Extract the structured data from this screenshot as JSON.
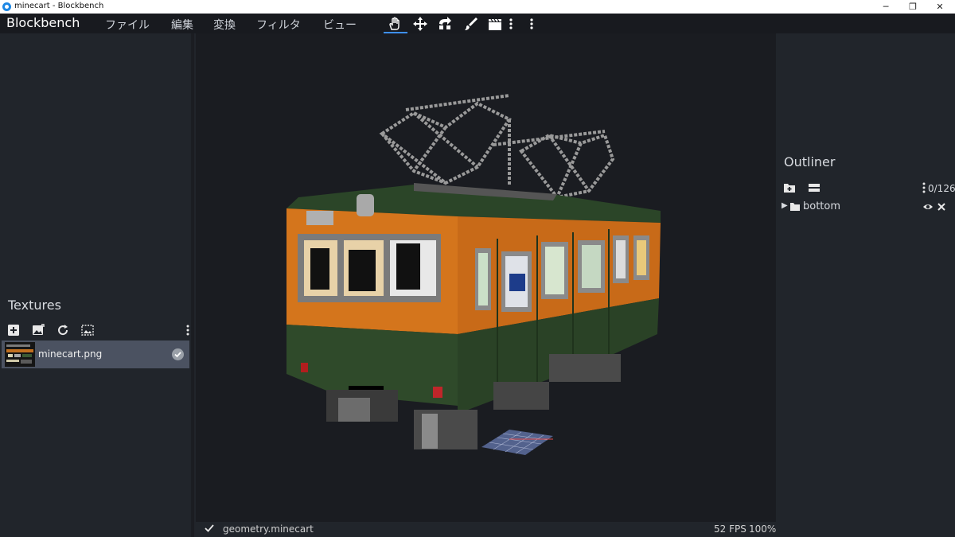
{
  "window": {
    "title": "minecart - Blockbench",
    "minimize": "─",
    "maximize": "❐",
    "close": "✕"
  },
  "menubar": {
    "brand": "Blockbench",
    "items": [
      "ファイル",
      "編集",
      "変換",
      "フィルタ",
      "ビュー"
    ],
    "tools": [
      "hand-icon",
      "move-icon",
      "rotate-icon",
      "paint-brush-icon",
      "clapperboard-icon"
    ]
  },
  "textures": {
    "title": "Textures",
    "items": [
      {
        "name": "minecart.png"
      }
    ]
  },
  "outliner": {
    "title": "Outliner",
    "count": "0/126",
    "items": [
      {
        "name": "bottom"
      }
    ]
  },
  "status": {
    "model": "geometry.minecart",
    "fps": "52 FPS",
    "zoom": "100%"
  },
  "colors": {
    "accent": "#3e90ff",
    "train_orange": "#d4751c",
    "train_green": "#2f4a2a"
  }
}
